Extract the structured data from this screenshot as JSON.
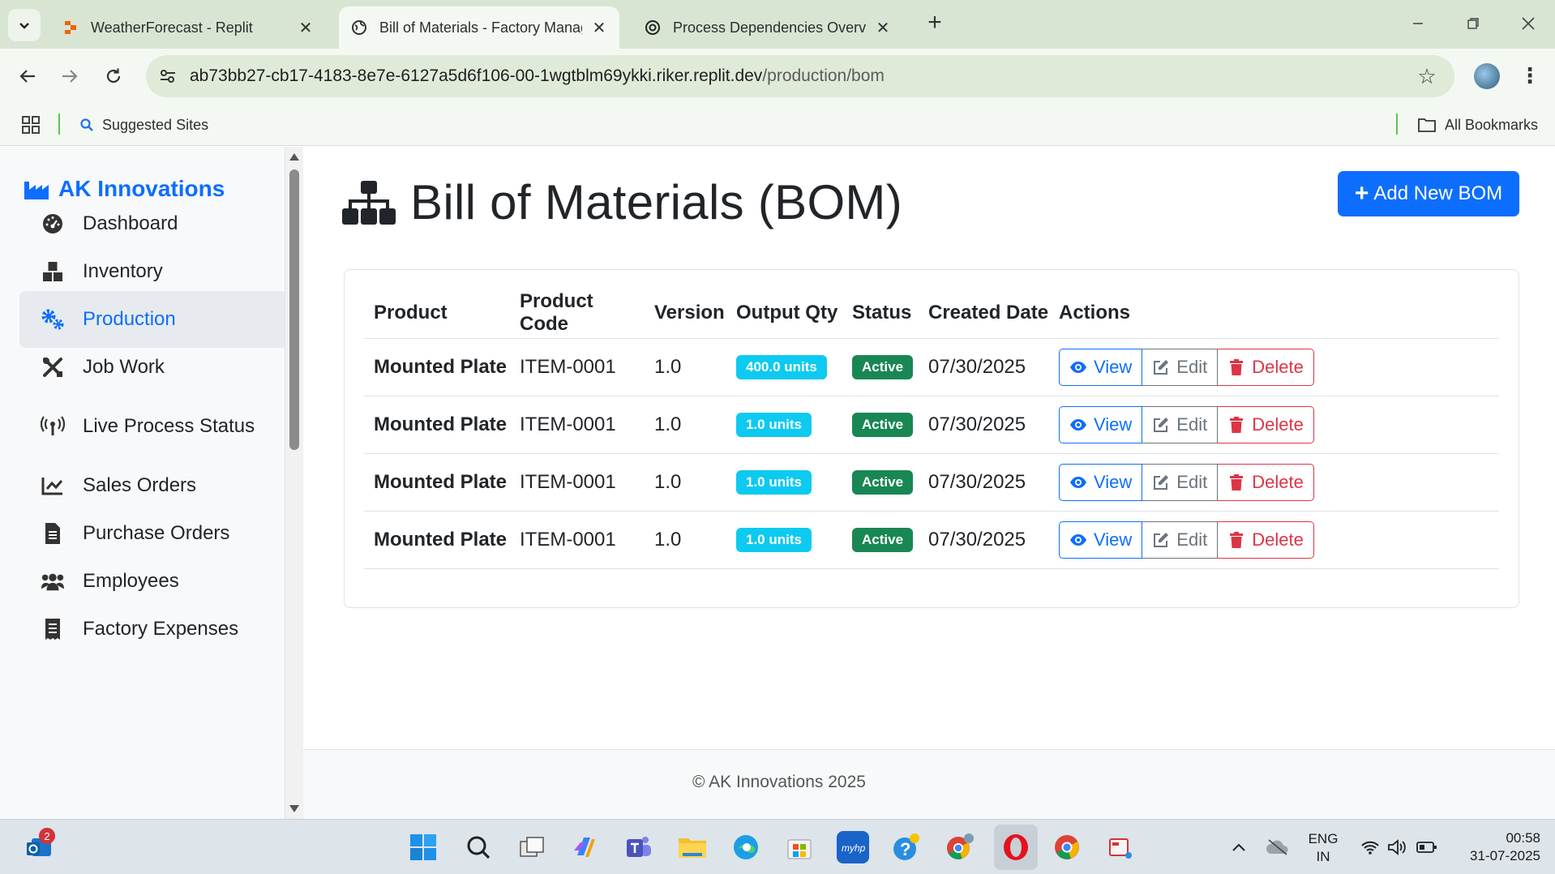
{
  "browser": {
    "tabs": [
      {
        "title": "WeatherForecast - Replit",
        "active": false
      },
      {
        "title": "Bill of Materials - Factory Manag",
        "active": true
      },
      {
        "title": "Process Dependencies Overview",
        "active": false
      }
    ],
    "url_host": "ab73bb27-cb17-4183-8e7e-6127a5d6f106-00-1wgtblm69ykki.riker.replit.dev",
    "url_path": "/production/bom",
    "bookmarks": {
      "suggested": "Suggested Sites",
      "all": "All Bookmarks"
    }
  },
  "sidebar": {
    "brand": "AK Innovations",
    "items": [
      {
        "label": "Dashboard",
        "icon": "dashboard-icon"
      },
      {
        "label": "Inventory",
        "icon": "inventory-icon"
      },
      {
        "label": "Production",
        "icon": "cogs-icon",
        "active": true
      },
      {
        "label": "Job Work",
        "icon": "tools-icon"
      },
      {
        "label": "Live Process Status",
        "icon": "broadcast-icon"
      },
      {
        "label": "Sales Orders",
        "icon": "chart-line-icon"
      },
      {
        "label": "Purchase Orders",
        "icon": "file-invoice-icon"
      },
      {
        "label": "Employees",
        "icon": "users-icon"
      },
      {
        "label": "Factory Expenses",
        "icon": "receipt-icon"
      }
    ]
  },
  "page": {
    "title": "Bill of Materials (BOM)",
    "add_button": "Add New BOM"
  },
  "table": {
    "headers": [
      "Product",
      "Product Code",
      "Version",
      "Output Qty",
      "Status",
      "Created Date",
      "Actions"
    ],
    "rows": [
      {
        "product": "Mounted Plate",
        "code": "ITEM-0001",
        "version": "1.0",
        "qty": "400.0 units",
        "status": "Active",
        "date": "07/30/2025"
      },
      {
        "product": "Mounted Plate",
        "code": "ITEM-0001",
        "version": "1.0",
        "qty": "1.0 units",
        "status": "Active",
        "date": "07/30/2025"
      },
      {
        "product": "Mounted Plate",
        "code": "ITEM-0001",
        "version": "1.0",
        "qty": "1.0 units",
        "status": "Active",
        "date": "07/30/2025"
      },
      {
        "product": "Mounted Plate",
        "code": "ITEM-0001",
        "version": "1.0",
        "qty": "1.0 units",
        "status": "Active",
        "date": "07/30/2025"
      }
    ],
    "actions": {
      "view": "View",
      "edit": "Edit",
      "delete": "Delete"
    }
  },
  "footer": {
    "text": "© AK Innovations 2025"
  },
  "taskbar": {
    "notification_count": "2",
    "lang_line1": "ENG",
    "lang_line2": "IN",
    "time": "00:58",
    "date": "31-07-2025"
  },
  "colors": {
    "primary": "#0d6efd",
    "info": "#0dcaf0",
    "success": "#198754",
    "danger": "#dc3545",
    "secondary": "#6c757d"
  }
}
